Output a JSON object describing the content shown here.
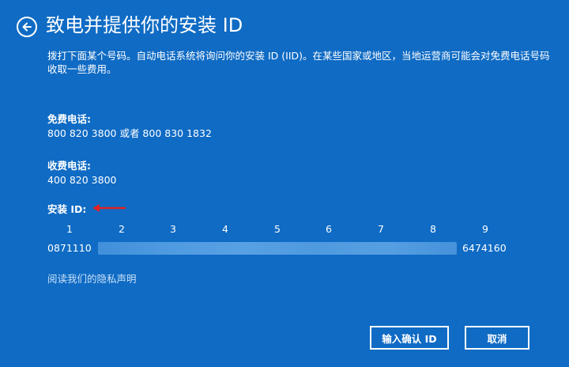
{
  "header": {
    "title": "致电并提供你的安装 ID",
    "back_icon": "arrow-left-circle-icon"
  },
  "intro_text": "拨打下面某个号码。自动电话系统将询问你的安装 ID (IID)。在某些国家或地区，当地运营商可能会对免费电话号码收取一些费用。",
  "toll_free": {
    "label": "免费电话:",
    "numbers": "800 820 3800 或者 800 830 1832"
  },
  "toll": {
    "label": "收费电话:",
    "number": "400 820 3800"
  },
  "installation_id": {
    "label": "安装 ID:",
    "annotation_color": "#e02424",
    "columns": [
      "1",
      "2",
      "3",
      "4",
      "5",
      "6",
      "7",
      "8",
      "9"
    ],
    "first_group": "0871110",
    "last_group": "6474160"
  },
  "privacy_link": "阅读我们的隐私声明",
  "buttons": {
    "enter_id": "输入确认 ID",
    "cancel": "取消"
  },
  "colors": {
    "background": "#0f6bc4",
    "text": "#ffffff",
    "link": "#c8e0f8"
  }
}
